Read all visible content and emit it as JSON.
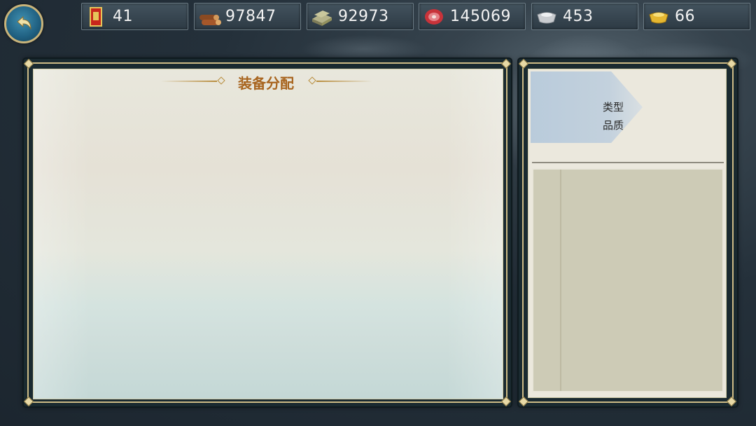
{
  "resources": [
    {
      "name": "token",
      "icon": "order-scroll-icon",
      "value": "41"
    },
    {
      "name": "wood",
      "icon": "wood-logs-icon",
      "value": "97847"
    },
    {
      "name": "stone",
      "icon": "stone-slab-icon",
      "value": "92973"
    },
    {
      "name": "food",
      "icon": "meat-icon",
      "value": "145069"
    },
    {
      "name": "silver",
      "icon": "silver-ingot-icon",
      "value": "453"
    },
    {
      "name": "gold",
      "icon": "gold-ingot-icon",
      "value": "66"
    }
  ],
  "main_panel": {
    "title": "装备分配"
  },
  "side_panel": {
    "filter_type_label": "类型",
    "filter_quality_label": "品质"
  },
  "colors": {
    "accent_gold": "#cdbb86",
    "title_brown": "#a8641e"
  }
}
